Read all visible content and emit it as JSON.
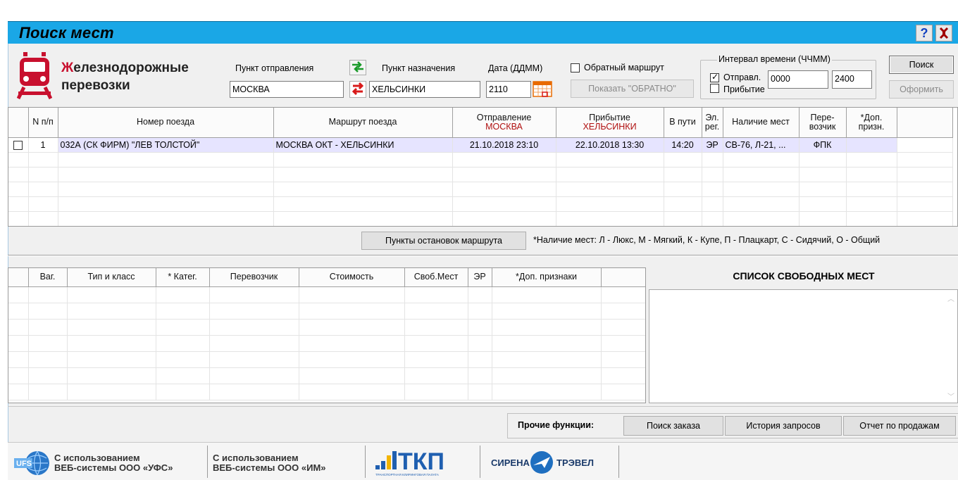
{
  "window": {
    "title": "Поиск мест",
    "help_label": "?",
    "close_label": "X"
  },
  "brand": {
    "line1_first": "Ж",
    "line1_rest": "елезнодорожные",
    "line2": "перевозки"
  },
  "search": {
    "from_label": "Пункт отправления",
    "from_value": "МОСКВА",
    "to_label": "Пункт назначения",
    "to_value": "ХЕЛЬСИНКИ",
    "date_label": "Дата (ДДММ)",
    "date_value": "2110",
    "return_route_label": "Обратный маршрут",
    "return_route_checked": false,
    "show_return_label": "Показать \"ОБРАТНО\"",
    "interval_label": "Интервал времени (ЧЧММ)",
    "departure_label": "Отправл.",
    "departure_checked": true,
    "arrival_label": "Прибытие",
    "arrival_checked": false,
    "time_from": "0000",
    "time_to": "2400",
    "search_button": "Поиск",
    "order_button": "Оформить"
  },
  "trains_table": {
    "headers": {
      "num": "N п/п",
      "train": "Номер поезда",
      "route": "Маршрут поезда",
      "departure": "Отправление",
      "departure_city": "МОСКВА",
      "arrival": "Прибытие",
      "arrival_city": "ХЕЛЬСИНКИ",
      "travel": "В пути",
      "er": "Эл. рег.",
      "seats": "Наличие мест",
      "carrier": "Пере- возчик",
      "extra": "*Доп. призн."
    },
    "rows": [
      {
        "num": "1",
        "train": "032А  (СК ФИРМ)  \"ЛЕВ ТОЛСТОЙ\"",
        "route": "МОСКВА ОКТ - ХЕЛЬСИНКИ",
        "departure": "21.10.2018  23:10",
        "arrival": "22.10.2018  13:30",
        "travel": "14:20",
        "er": "ЭР",
        "seats": "СВ-76, Л-21, ...",
        "carrier": "ФПК",
        "extra": ""
      }
    ]
  },
  "stops_button": "Пункты остановок маршрута",
  "legend": "*Наличие мест:  Л - Люкс, М - Мягкий, К - Купе, П - Плацкарт,  С - Сидячий, О - Общий",
  "cars_table": {
    "headers": {
      "car": "Ваг.",
      "type": "Тип и класс",
      "cat": "* Катег.",
      "carrier": "Перевозчик",
      "price": "Стоимость",
      "free": "Своб.Мест",
      "er": "ЭР",
      "extra": "*Доп. признаки"
    }
  },
  "free_seats_title": "СПИСОК СВОБОДНЫХ МЕСТ",
  "other": {
    "label": "Прочие функции:",
    "order_search": "Поиск заказа",
    "history": "История запросов",
    "sales_report": "Отчет по продажам"
  },
  "footer": {
    "ufs_logo": "UFS",
    "ufs_line1": "С использованием",
    "ufs_line2": "ВЕБ-системы ООО «УФС»",
    "im_line1": "С использованием",
    "im_line2": "ВЕБ-системы ООО «ИМ»",
    "tkp_logo": "ТКП",
    "tkp_sub": "ТРАНСПОРТНАЯ КЛИРИНГОВАЯ ПАЛАТА",
    "sirena": "СИРЕНА",
    "travel": "ТРЭВЕЛ"
  },
  "colors": {
    "titlebar": "#1aa7e6",
    "brand_red": "#c8102e",
    "selected_row": "#e6e4ff",
    "header_red": "#b01010"
  }
}
